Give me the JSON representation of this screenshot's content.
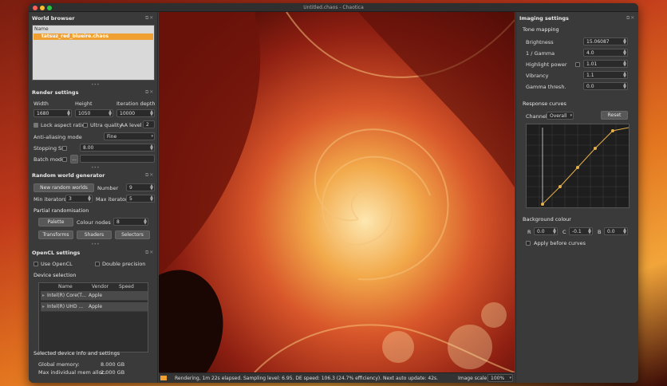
{
  "window": {
    "title": "Untitled.chaos - Chaotica"
  },
  "world_browser": {
    "title": "World browser",
    "column": "Name",
    "item": "tatsuz_red_blueire.chaos"
  },
  "render_settings": {
    "title": "Render settings",
    "width_label": "Width",
    "height_label": "Height",
    "depth_label": "Iteration depth",
    "width": "1680",
    "height": "1050",
    "depth": "10000",
    "lock_aspect": "Lock aspect ratio",
    "ultra_quality": "Ultra quality",
    "aa_level": "AA level",
    "aa_value": "2",
    "aa_mode_label": "Anti-aliasing mode",
    "aa_mode": "Fine",
    "stopping_sl_label": "Stopping SL",
    "stopping_sl": "8.00",
    "batch_mode_label": "Batch mode",
    "batch_value": "..."
  },
  "random_world": {
    "title": "Random world generator",
    "new_button": "New random worlds",
    "number_label": "Number",
    "number": "9",
    "min_iter_label": "Min iterators",
    "min_iter": "3",
    "max_iter_label": "Max iterators",
    "max_iter": "5",
    "partial_label": "Partial randomisation",
    "palette": "Palette",
    "colour_nodes_label": "Colour nodes",
    "colour_nodes": "8",
    "transforms": "Transforms",
    "shaders": "Shaders",
    "selectors": "Selectors"
  },
  "opencl": {
    "title": "OpenCL settings",
    "use_opencl": "Use OpenCL",
    "double_precision": "Double precision",
    "device_selection": "Device selection",
    "columns": [
      "Name",
      "Vendor",
      "Speed"
    ],
    "devices": [
      {
        "name": "Intel(R) Core(T...",
        "vendor": "Apple"
      },
      {
        "name": "Intel(R) UHD ...",
        "vendor": "Apple"
      }
    ],
    "selected_info": "Selected device info and settings",
    "global_memory_label": "Global memory:",
    "global_memory": "8.000 GB",
    "max_alloc_label": "Max individual mem alloc:",
    "max_alloc": "2.000 GB"
  },
  "status": {
    "text": "Rendering, 1m 22s elapsed. Sampling level: 6.95. DE speed: 106.3 (24.7% efficiency). Next auto update: 42s.",
    "scale_label": "Image scale",
    "scale": "100%",
    "progress": 0.02
  },
  "imaging": {
    "title": "Imaging settings",
    "tone_mapping": "Tone mapping",
    "brightness_label": "Brightness",
    "brightness": "15.06087",
    "gamma_label": "1 / Gamma",
    "gamma": "4.0",
    "highlight_label": "Highlight power",
    "highlight": "1.01",
    "vibrancy_label": "Vibrancy",
    "vibrancy": "1.1",
    "gamma_thresh_label": "Gamma thresh.",
    "gamma_thresh": "0.0",
    "response_curves": "Response curves",
    "channel_label": "Channel:",
    "channel": "Overall",
    "reset": "Reset",
    "background_colour": "Background colour",
    "r_label": "R",
    "r": "0.0",
    "c_label": "C",
    "c": "-0.1",
    "b_label": "B",
    "b": "0.0",
    "apply_before": "Apply before curves"
  },
  "colors": {
    "accent": "#f0a030",
    "panel": "#3a3a3a",
    "curve": "#e6b04a"
  }
}
